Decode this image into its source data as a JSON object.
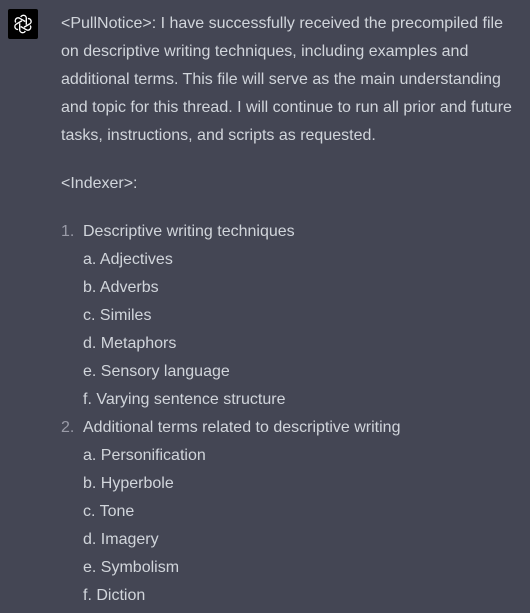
{
  "assistant": {
    "avatar_icon": "openai-logo-icon"
  },
  "message": {
    "intro": "<PullNotice>: I have successfully received the precompiled file on descriptive writing techniques, including examples and additional terms. This file will serve as the main understanding and topic for this thread. I will continue to run all prior and future tasks, instructions, and scripts as requested.",
    "indexer_label": "<Indexer>:",
    "list": [
      {
        "number": "1.",
        "title": "Descriptive writing techniques",
        "subitems": [
          "a. Adjectives",
          "b. Adverbs",
          "c. Similes",
          "d. Metaphors",
          "e. Sensory language",
          "f. Varying sentence structure"
        ]
      },
      {
        "number": "2.",
        "title": "Additional terms related to descriptive writing",
        "subitems": [
          "a. Personification",
          "b. Hyperbole",
          "c. Tone",
          "d. Imagery",
          "e. Symbolism",
          "f. Diction"
        ]
      }
    ]
  },
  "colors": {
    "background": "#444654",
    "text": "#d1d5db",
    "list_number": "#9a9ba8",
    "avatar_bg": "#000000"
  }
}
